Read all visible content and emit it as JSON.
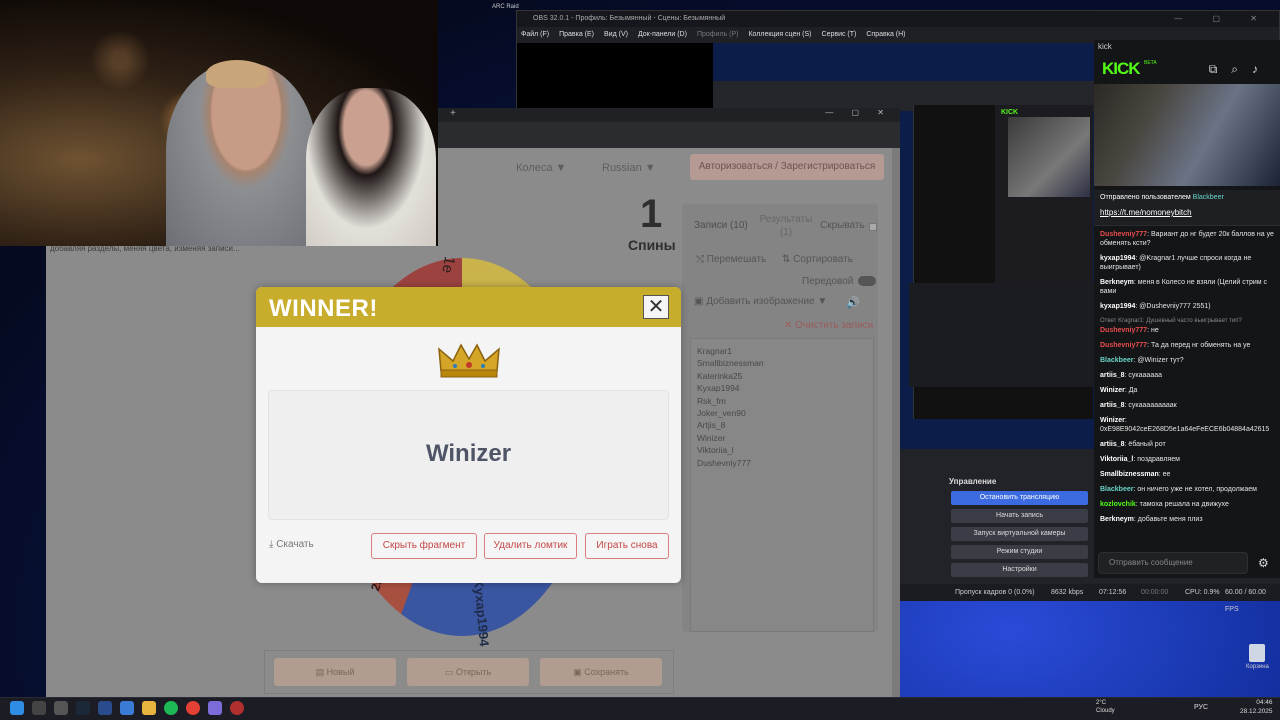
{
  "obs": {
    "title": "OBS 32.0.1 - Профиль: Безымянный - Сцены: Безымянный",
    "menu": [
      "Файл (F)",
      "Правка (E)",
      "Вид (V)",
      "Док-панели (D)",
      "Профиль (P)",
      "Коллекция сцен (S)",
      "Сервис (T)",
      "Справка (H)"
    ],
    "controls_title": "Управление",
    "buttons": [
      "Остановить трансляцию",
      "Начать запись",
      "Запуск виртуальной камеры",
      "Режим студии",
      "Настройки"
    ],
    "status": {
      "dropped": "Пропуск кадров 0 (0.0%)",
      "bitrate": "8632 kbps",
      "live": "07:12:56",
      "rec": "00:00:00",
      "cpu": "CPU: 0.9%",
      "fps": "60.00 / 60.00 FPS"
    }
  },
  "kick": {
    "window_title": "kick",
    "logo": "KICK",
    "beta": "BETA",
    "pinned_header": "Отправлено пользователем",
    "pinned_user": "Blackbeer",
    "pinned_link": "https://t.me/nomoneybitch",
    "input_placeholder": "Отправить сообщение",
    "messages": [
      {
        "user": "Dushevniy777",
        "cls": "u-red",
        "text": ": Вариант до нг будет 20к баллов на уе обменять ксти?"
      },
      {
        "user": "kyxap1994",
        "cls": "u-white",
        "text": ": @Kragnar1 лучше спроси когда не выигрывает)"
      },
      {
        "user": "Berkneym",
        "cls": "u-white",
        "text": ": меня в Колесо не взяли (Целий стрим с вами"
      },
      {
        "user": "kyxap1994",
        "cls": "u-white",
        "text": ": @Dushevniy777 2551)"
      },
      {
        "reply": "Ответ Kragnar1: Душевный часто выигрывает тип?",
        "user": "Dushevniy777",
        "cls": "u-red",
        "text": ": не"
      },
      {
        "user": "Dushevniy777",
        "cls": "u-red",
        "text": ": Та да перед нг обменять на уе"
      },
      {
        "user": "Blackbeer",
        "cls": "u-teal",
        "text": ": @Winizer тут?"
      },
      {
        "user": "artiis_8",
        "cls": "u-white",
        "text": ": сукаааааа"
      },
      {
        "user": "Winizer",
        "cls": "u-white",
        "text": ": Да"
      },
      {
        "user": "artiis_8",
        "cls": "u-white",
        "text": ": сукааааааааак"
      },
      {
        "user": "Winizer",
        "cls": "u-white",
        "text": ": 0xE98E9042ceE268D5e1a64eFeECE6b04884a42615"
      },
      {
        "user": "artiis_8",
        "cls": "u-white",
        "text": ": ёбаный рот"
      },
      {
        "user": "Viktoriia_l",
        "cls": "u-white",
        "text": ": поздравляем"
      },
      {
        "user": "Smallbiznessman",
        "cls": "u-white",
        "text": ": ее"
      },
      {
        "user": "Blackbeer",
        "cls": "u-teal",
        "text": ": он ничего уже не хотел, продолжаем"
      },
      {
        "user": "kozlovchik",
        "cls": "u-green",
        "text": ": тамоха решала на движуxe"
      },
      {
        "user": "Berkneym",
        "cls": "u-white",
        "text": ": добавьте меня плиз"
      }
    ]
  },
  "wheel_app": {
    "nav_wheels": "Колеса ▼",
    "nav_lang": "Russian ▼",
    "auth": "Авторизоваться / Зарегистрироваться",
    "spins_count": "1",
    "spins_label": "Спины",
    "tab_entries": "Записи (10)",
    "tab_results": "Результаты (1)",
    "hide": "Скрывать",
    "shuffle": "⤭ Перемешать",
    "sort": "⇅ Сортировать",
    "advanced": "Передовой",
    "add_image": "Добавить изображение ▼",
    "clear": "✕ Очистить записи",
    "entries": [
      "Kragnar1",
      "Smallbiznessman",
      "Katerinka25",
      "Kyxap1994",
      "Rsk_fm",
      "Joker_ven90",
      "Artjis_8",
      "Winizer",
      "Viktoriia_l",
      "Dushevniy777"
    ],
    "wheel_labels": [
      "1e",
      "Kyxap1994",
      "25"
    ],
    "btn_new": "Новый",
    "btn_open": "Открыть",
    "btn_save": "Сохранять",
    "overlay_text": "добавляя разделы, меняя цвета, изменяя записи..."
  },
  "modal": {
    "title": "WINNER!",
    "close": "✕",
    "winner": "Winizer",
    "download": "Скачать",
    "btn_clip": "Скрыть фрагмент",
    "btn_remove": "Удалить ломтик",
    "btn_again": "Играть снова"
  },
  "taskbar": {
    "weather_temp": "2°C",
    "weather_desc": "Cloudy",
    "lang": "РУС",
    "time": "04:46",
    "date": "28.12.2025"
  },
  "desktop": {
    "recycle_bin": "Корзина",
    "arc_label": "ARC Raid"
  },
  "colors": {
    "modal_header": "#c8ac2c",
    "accent_red": "#c44848",
    "kick_green": "#53fc18",
    "obs_blue": "#3c6ae0"
  }
}
